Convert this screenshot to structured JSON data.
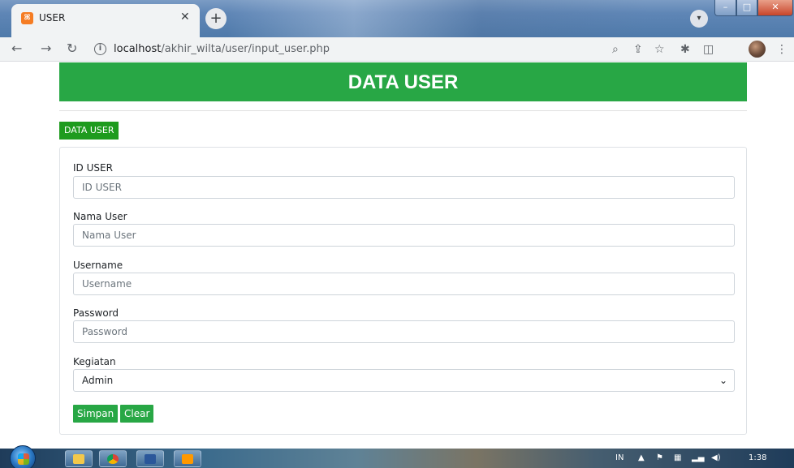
{
  "browser": {
    "tab_title": "USER",
    "tab_favicon": "xampp-icon",
    "url_host": "localhost",
    "url_path": "/akhir_wilta/user/input_user.php"
  },
  "page": {
    "header_title": "DATA USER",
    "data_user_button": "DATA USER",
    "form": {
      "id_user": {
        "label": "ID USER",
        "placeholder": "ID USER",
        "value": ""
      },
      "nama_user": {
        "label": "Nama User",
        "placeholder": "Nama User",
        "value": ""
      },
      "username": {
        "label": "Username",
        "placeholder": "Username",
        "value": ""
      },
      "password": {
        "label": "Password",
        "placeholder": "Password",
        "value": ""
      },
      "kegiatan": {
        "label": "Kegiatan",
        "selected": "Admin"
      }
    },
    "buttons": {
      "save": "Simpan",
      "clear": "Clear"
    }
  },
  "taskbar": {
    "language": "IN",
    "clock": "1:38"
  },
  "colors": {
    "header_green": "#28a745",
    "button_green": "#1e9b1e"
  }
}
